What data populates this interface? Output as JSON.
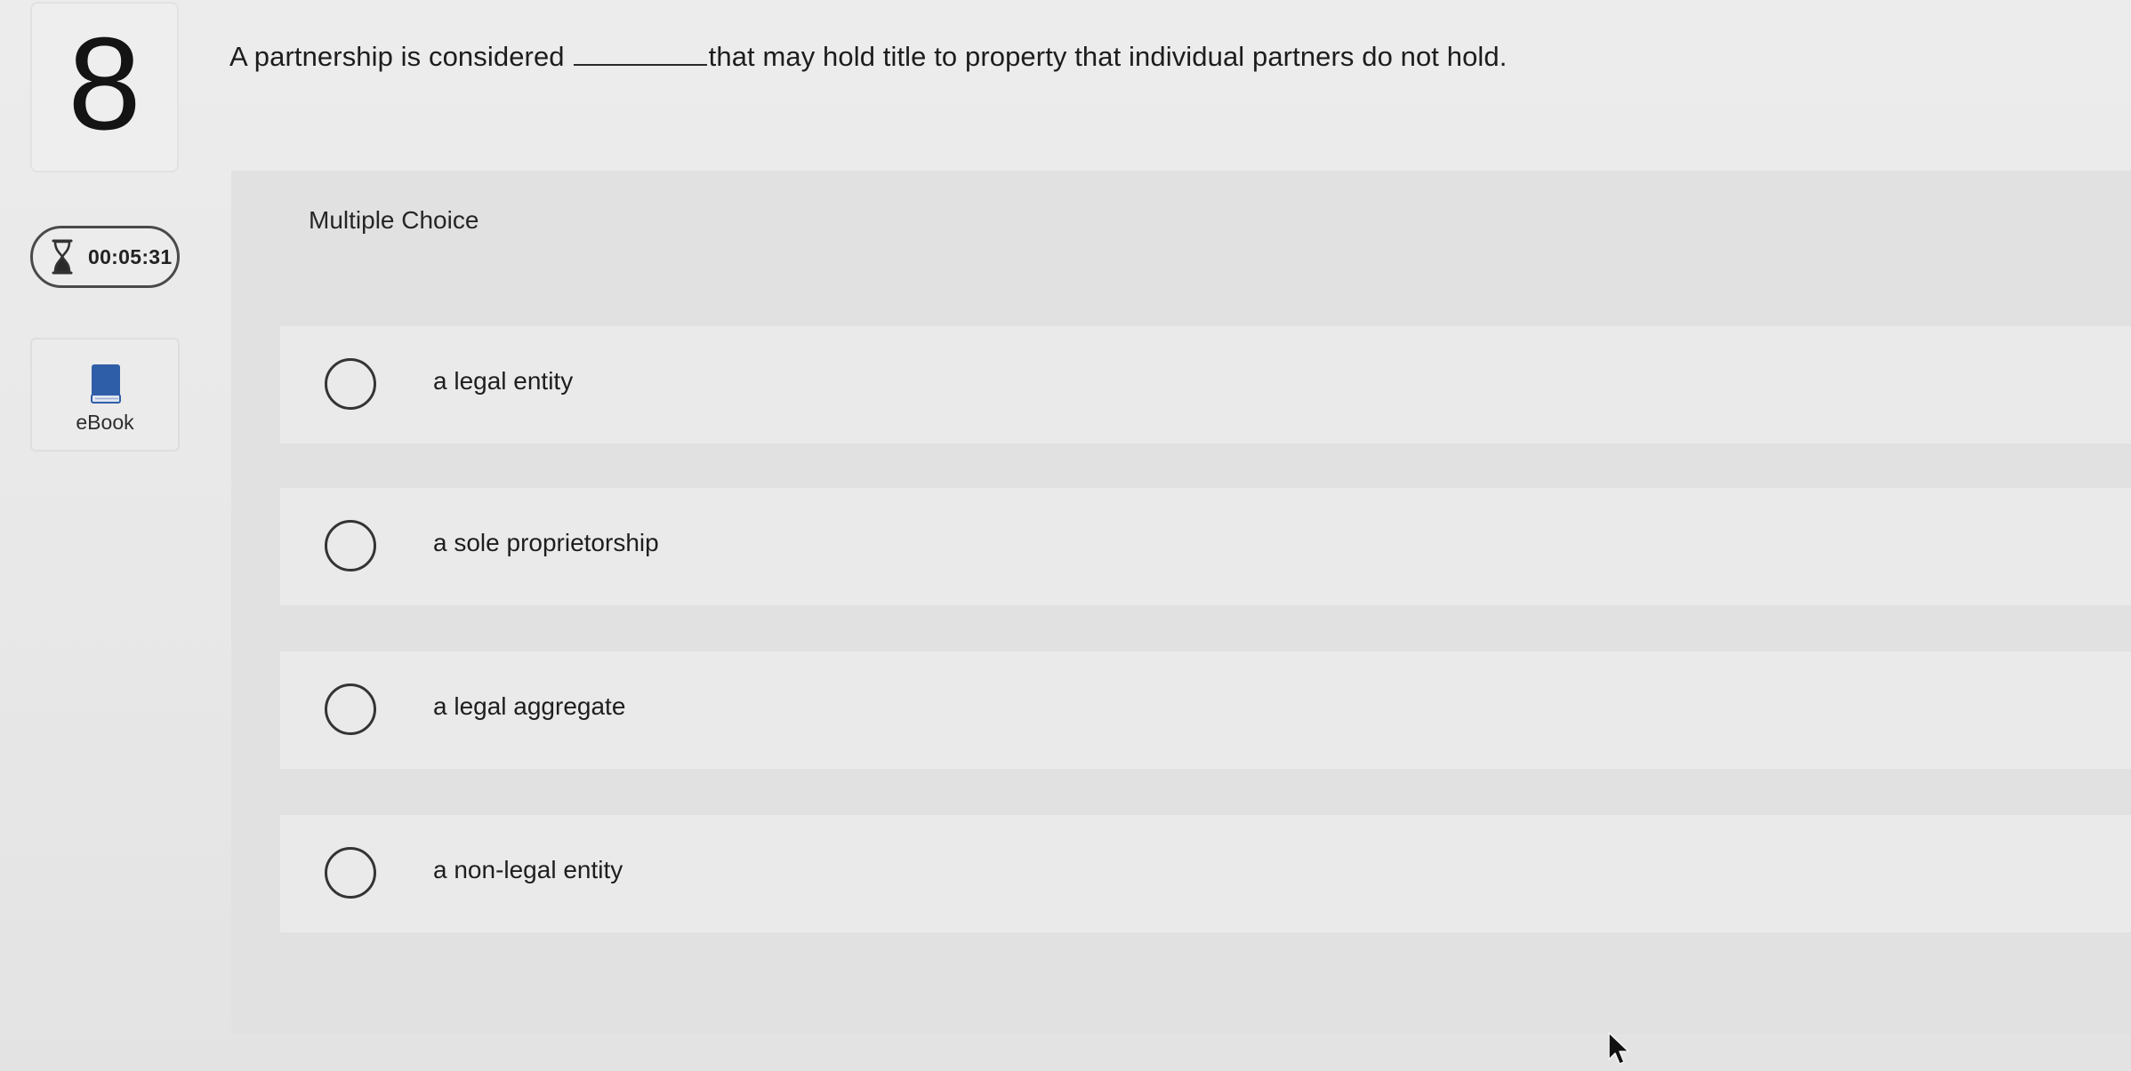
{
  "question": {
    "number": "8",
    "text_before": "A partnership is considered",
    "text_after": "that may hold title to property that individual partners do not hold."
  },
  "timer": {
    "icon": "hourglass-icon",
    "value": "00:05:31"
  },
  "ebook": {
    "icon": "book-icon",
    "label": "eBook",
    "icon_color": "#2f5ea8"
  },
  "answer_panel": {
    "label": "Multiple Choice",
    "choices": [
      {
        "label": "a legal entity",
        "selected": false
      },
      {
        "label": "a sole proprietorship",
        "selected": false
      },
      {
        "label": "a legal aggregate",
        "selected": false
      },
      {
        "label": "a non-legal entity",
        "selected": false
      }
    ]
  }
}
